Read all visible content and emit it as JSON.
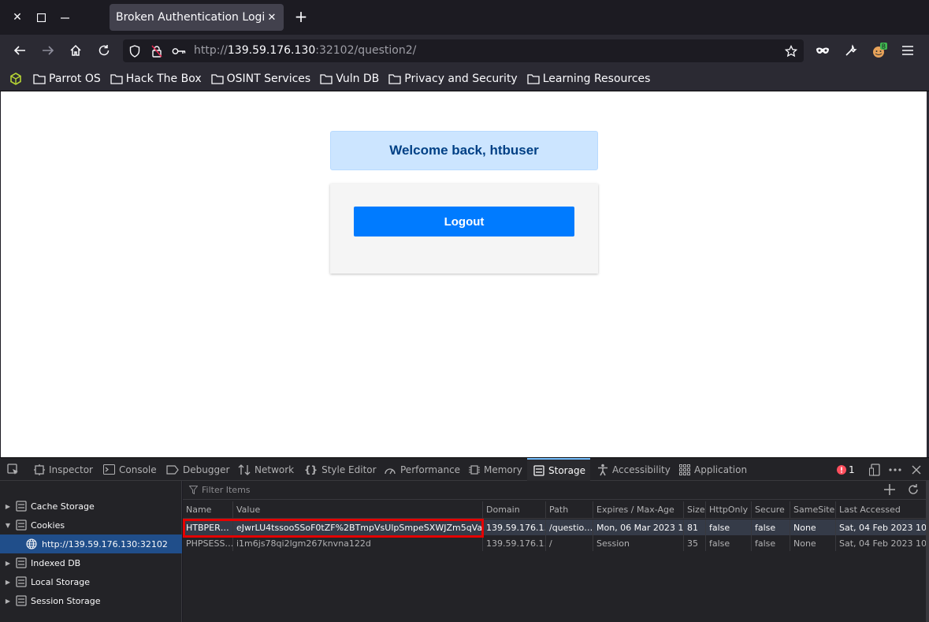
{
  "browser": {
    "tab_title": "Broken Authentication Login",
    "url_prefix": "http://",
    "url_host": "139.59.176.130",
    "url_rest": ":32102/question2/",
    "extension_badge": "B"
  },
  "bookmarks": [
    "Parrot OS",
    "Hack The Box",
    "OSINT Services",
    "Vuln DB",
    "Privacy and Security",
    "Learning Resources"
  ],
  "page": {
    "welcome": "Welcome back, htbuser",
    "logout_label": "Logout"
  },
  "devtools": {
    "tabs": [
      "Inspector",
      "Console",
      "Debugger",
      "Network",
      "Style Editor",
      "Performance",
      "Memory",
      "Storage",
      "Accessibility",
      "Application"
    ],
    "active_tab": "Storage",
    "error_count": "1",
    "filter_placeholder": "Filter Items",
    "sidebar": [
      "Cache Storage",
      "Cookies",
      "http://139.59.176.130:32102",
      "Indexed DB",
      "Local Storage",
      "Session Storage"
    ],
    "columns": [
      "Name",
      "Value",
      "Domain",
      "Path",
      "Expires / Max-Age",
      "Size",
      "HttpOnly",
      "Secure",
      "SameSite",
      "Last Accessed"
    ],
    "rows": [
      [
        "HTBPER…",
        "eJwrLU4tssooSSoF0tZF%2BTmpVsUlpSmpeSXWJZm5qVa…",
        "139.59.176.1…",
        "/questio…",
        "Mon, 06 Mar 2023 1…",
        "81",
        "false",
        "false",
        "None",
        "Sat, 04 Feb 2023 10…"
      ],
      [
        "PHPSESS…",
        "i1m6js78qi2lgm267knvna122d",
        "139.59.176.1…",
        "/",
        "Session",
        "35",
        "false",
        "false",
        "None",
        "Sat, 04 Feb 2023 10…"
      ]
    ]
  },
  "colors": {
    "accent": "#007bff",
    "alert_bg": "#cce5ff",
    "alert_text": "#004085",
    "highlight_box": "#e50000",
    "selected_row": "#204e8a"
  }
}
